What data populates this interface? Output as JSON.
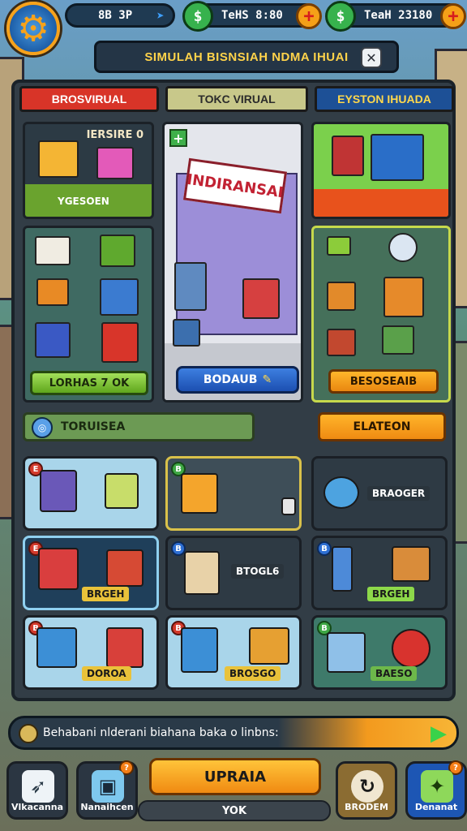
{
  "resources": {
    "time": "8B 3P",
    "coins": "TeHS 8:80",
    "total": "TeaH 23180"
  },
  "title": "SIMULAH BISNSIAH NDMA IHUAI",
  "tabs": [
    "BROSVIRUAL",
    "TOKC VIRUAL",
    "EYSTON IHUADA"
  ],
  "left_card": {
    "top_label": "IERSIRE",
    "code": "0",
    "bottom_label": "YGESOEN",
    "button": "LORHAS 7 OK"
  },
  "center_card": {
    "sign": "INDIRANSAI",
    "button": "BODAUB"
  },
  "right_card": {
    "button": "BESOSEAIB"
  },
  "section": {
    "title": "TORUISEA",
    "button": "ELATEON"
  },
  "items": [
    {
      "num": "E",
      "label": ""
    },
    {
      "num": "B",
      "label": ""
    },
    {
      "num": "",
      "label": "BRAOGER"
    },
    {
      "num": "E",
      "label": "BRGEH"
    },
    {
      "num": "B",
      "label": "BTOGL6"
    },
    {
      "num": "B",
      "label": "BRGEH"
    },
    {
      "num": "B",
      "label": "DOROA"
    },
    {
      "num": "B",
      "label": "BROSGO"
    },
    {
      "num": "B",
      "label": "BAESO"
    }
  ],
  "message": "Behabani nlderani biahana baka o linbns:",
  "nav": {
    "left1": "Vlkacanna",
    "left2": "Nanaihcen",
    "upgrade": "UPRAIA",
    "ok": "YOK",
    "right1": "BRODEM",
    "right2": "Denanat"
  },
  "colors": {
    "accent_orange": "#f5a018",
    "panel": "#323d46",
    "tab_red": "#d83428",
    "tab_blue": "#1d5096"
  }
}
